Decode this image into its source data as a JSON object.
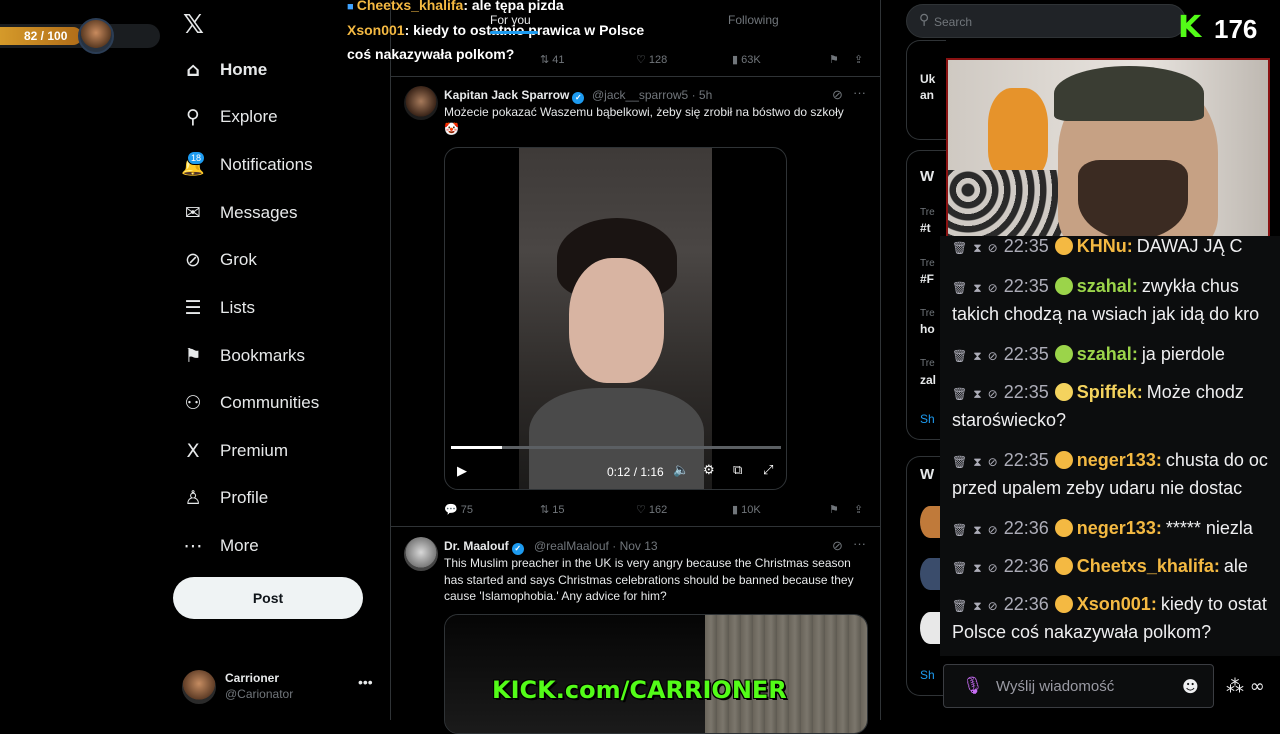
{
  "overlay": {
    "level_badge": "82 / 100",
    "level_fraction": 0.82,
    "kick_count": "176"
  },
  "stream_chat_top": [
    {
      "user": "Cheetxs_khalifa",
      "text": ": ale tępa pizda",
      "color": "#f4b942"
    },
    {
      "user": "Xson001",
      "text": ": kiedy to ostatnio prawica w Polsce",
      "color": "#f4b942"
    },
    {
      "text2": "coś nakazywała polkom?"
    }
  ],
  "sidebar": {
    "items": [
      {
        "label": "Home",
        "icon": "home-icon",
        "glyph": "⌂"
      },
      {
        "label": "Explore",
        "icon": "search-icon",
        "glyph": "⚲"
      },
      {
        "label": "Notifications",
        "icon": "bell-icon",
        "glyph": "🔔",
        "badge": "18"
      },
      {
        "label": "Messages",
        "icon": "mail-icon",
        "glyph": "✉"
      },
      {
        "label": "Grok",
        "icon": "grok-icon",
        "glyph": "⊘"
      },
      {
        "label": "Lists",
        "icon": "list-icon",
        "glyph": "☰"
      },
      {
        "label": "Bookmarks",
        "icon": "bookmark-icon",
        "glyph": "⚑"
      },
      {
        "label": "Communities",
        "icon": "communities-icon",
        "glyph": "⚇"
      },
      {
        "label": "Premium",
        "icon": "x-icon",
        "glyph": "X"
      },
      {
        "label": "Profile",
        "icon": "person-icon",
        "glyph": "♙"
      },
      {
        "label": "More",
        "icon": "more-circle-icon",
        "glyph": "⋯"
      }
    ],
    "post_label": "Post",
    "account": {
      "name": "Carrioner",
      "handle": "@Carionator"
    }
  },
  "feed": {
    "tabs": [
      "For you",
      "Following"
    ],
    "prev_actions": {
      "retweets": "41",
      "likes": "128",
      "views": "63K"
    },
    "tweets": [
      {
        "name": "Kapitan Jack Sparrow",
        "handle": "@jack__sparrow5",
        "time": "· 5h",
        "text": "Możecie pokazać Waszemu bąbelkowi, żeby się zrobił na bóstwo do szkoły",
        "emoji": "🤡",
        "video_time": "0:12 / 1:16",
        "video_progress": 0.154,
        "replies": "75",
        "retweets": "15",
        "likes": "162",
        "views": "10K"
      },
      {
        "name": "Dr. Maalouf",
        "handle": "@realMaalouf",
        "time": "· Nov 13",
        "text": "This Muslim preacher in the UK is very angry because the Christmas season has started and says Christmas celebrations should be banned because they cause 'Islamophobia.' Any advice for him?",
        "watermark": "KICK.com/CARRIONER"
      }
    ]
  },
  "right": {
    "search_placeholder": "Search",
    "partial_texts": [
      "Uk",
      "an",
      "W",
      "Tre",
      "#t",
      "Tre",
      "#F",
      "Tre",
      "ho",
      "Tre",
      "zal",
      "Sh",
      "W",
      "Sh"
    ]
  },
  "chat": {
    "messages": [
      {
        "time": "22:35",
        "user": "KHNu",
        "text": "DAWAJ JĄ C",
        "color": "#f4b942"
      },
      {
        "time": "22:35",
        "user": "szahal",
        "text": "zwykła chus",
        "cont": "takich chodzą na wsiach jak idą do kro",
        "color": "#9bd44a"
      },
      {
        "time": "22:35",
        "user": "szahal",
        "text": "ja pierdole",
        "color": "#9bd44a"
      },
      {
        "time": "22:35",
        "user": "Spiffek",
        "text": "Może chodz",
        "cont": "staroświecko?",
        "color": "#f4d35e"
      },
      {
        "time": "22:35",
        "user": "neger133",
        "text": "chusta do oc",
        "cont": "przed upalem zeby udaru nie dostac",
        "color": "#f4b942"
      },
      {
        "time": "22:36",
        "user": "neger133",
        "text": "***** niezla",
        "color": "#f4b942"
      },
      {
        "time": "22:36",
        "user": "Cheetxs_khalifa",
        "text": "ale",
        "color": "#f4b942"
      },
      {
        "time": "22:36",
        "user": "Xson001",
        "text": "kiedy to ostat",
        "cont": "Polsce coś nakazywała polkom?",
        "color": "#f4b942"
      }
    ],
    "input_placeholder": "Wyślij wiadomość"
  }
}
